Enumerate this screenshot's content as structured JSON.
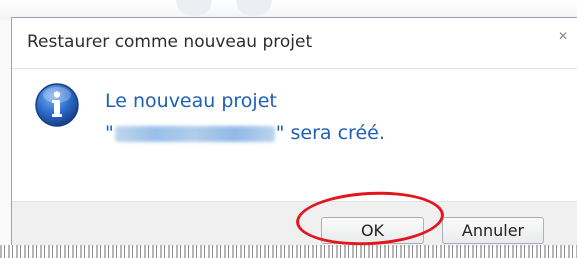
{
  "dialog": {
    "title": "Restaurer comme nouveau projet",
    "close_glyph": "✕",
    "message": {
      "line1": "Le nouveau projet",
      "line2_prefix": "\"",
      "line2_suffix": "\" sera créé."
    },
    "icon": "info-icon",
    "buttons": {
      "ok_label": "OK",
      "cancel_label": "Annuler"
    }
  },
  "colors": {
    "message_text": "#1f5fb8",
    "annotation_circle": "#e2161b",
    "footer_bg": "#f0f0f0"
  }
}
